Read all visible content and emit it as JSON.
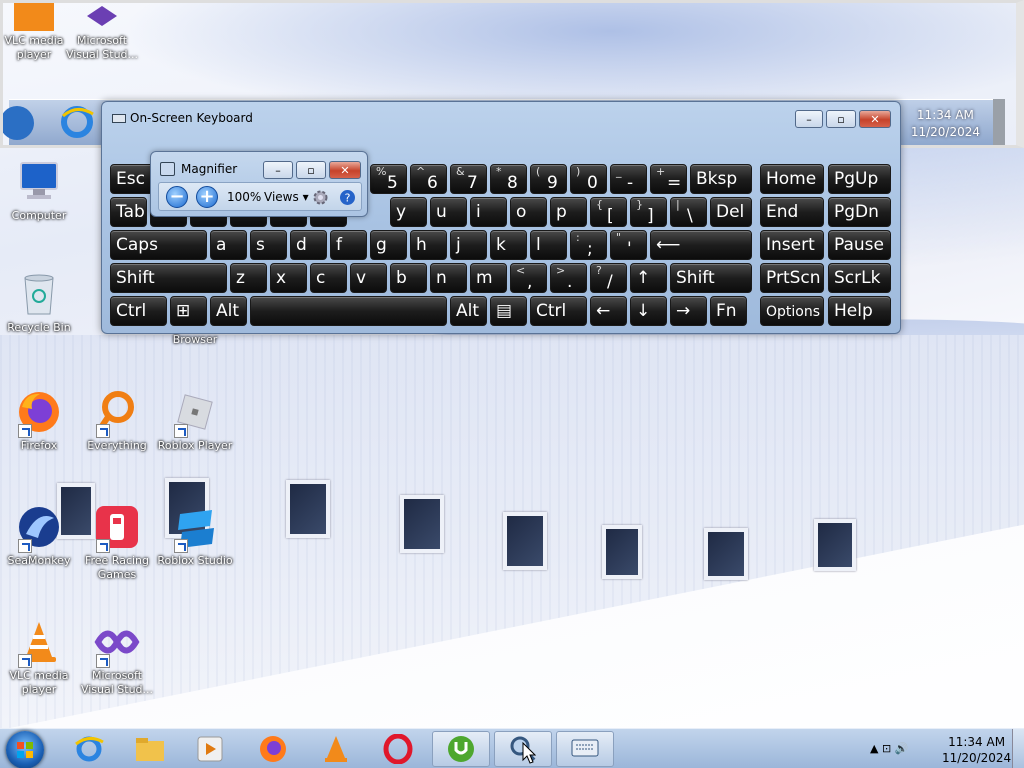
{
  "magnified_view": {
    "icons": [
      "VLC media player",
      "Microsoft Visual Stud..."
    ],
    "time": "11:34 AM",
    "date": "11/20/2024"
  },
  "desktop": {
    "icons": [
      {
        "label": "Computer",
        "icon": "computer-icon"
      },
      {
        "label": "Recycle Bin",
        "icon": "recycle-bin-icon"
      },
      {
        "label": "Browser",
        "icon": "browser-icon"
      },
      {
        "label": "Firefox",
        "icon": "firefox-icon"
      },
      {
        "label": "Everything",
        "icon": "everything-icon"
      },
      {
        "label": "Roblox Player",
        "icon": "roblox-player-icon"
      },
      {
        "label": "SeaMonkey",
        "icon": "seamonkey-icon"
      },
      {
        "label": "Free Racing Games",
        "icon": "racing-games-icon"
      },
      {
        "label": "Roblox Studio",
        "icon": "roblox-studio-icon"
      },
      {
        "label": "VLC media player",
        "icon": "vlc-icon"
      },
      {
        "label": "Microsoft Visual Stud...",
        "icon": "visual-studio-icon"
      }
    ]
  },
  "osk": {
    "title": "On-Screen Keyboard",
    "rows": [
      [
        {
          "s": "",
          "m": "Esc"
        },
        {
          "s": "",
          "m": ""
        },
        {
          "s": "",
          "m": ""
        },
        {
          "s": "",
          "m": ""
        },
        {
          "s": "",
          "m": ""
        },
        {
          "s": "",
          "m": ""
        },
        {
          "s": "%",
          "m": "5"
        },
        {
          "s": "^",
          "m": "6"
        },
        {
          "s": "&",
          "m": "7"
        },
        {
          "s": "*",
          "m": "8"
        },
        {
          "s": "(",
          "m": "9"
        },
        {
          "s": ")",
          "m": "0"
        },
        {
          "s": "_",
          "m": "-"
        },
        {
          "s": "+",
          "m": "="
        },
        {
          "s": "",
          "m": "Bksp"
        },
        {
          "s": "",
          "m": "Home"
        },
        {
          "s": "",
          "m": "PgUp"
        }
      ],
      [
        {
          "s": "",
          "m": "Tab"
        },
        {
          "s": "",
          "m": ""
        },
        {
          "s": "",
          "m": ""
        },
        {
          "s": "",
          "m": ""
        },
        {
          "s": "",
          "m": ""
        },
        {
          "s": "",
          "m": ""
        },
        {
          "s": "",
          "m": "y"
        },
        {
          "s": "",
          "m": "u"
        },
        {
          "s": "",
          "m": "i"
        },
        {
          "s": "",
          "m": "o"
        },
        {
          "s": "",
          "m": "p"
        },
        {
          "s": "{",
          "m": "["
        },
        {
          "s": "}",
          "m": "]"
        },
        {
          "s": "|",
          "m": "\\"
        },
        {
          "s": "",
          "m": "Del"
        },
        {
          "s": "",
          "m": "End"
        },
        {
          "s": "",
          "m": "PgDn"
        }
      ],
      [
        {
          "s": "",
          "m": "Caps"
        },
        {
          "s": "",
          "m": "a"
        },
        {
          "s": "",
          "m": "s"
        },
        {
          "s": "",
          "m": "d"
        },
        {
          "s": "",
          "m": "f"
        },
        {
          "s": "",
          "m": "g"
        },
        {
          "s": "",
          "m": "h"
        },
        {
          "s": "",
          "m": "j"
        },
        {
          "s": "",
          "m": "k"
        },
        {
          "s": "",
          "m": "l"
        },
        {
          "s": ":",
          "m": ";"
        },
        {
          "s": "\"",
          "m": "'"
        },
        {
          "s": "",
          "m": "⟵"
        },
        {
          "s": "",
          "m": "Insert"
        },
        {
          "s": "",
          "m": "Pause"
        }
      ],
      [
        {
          "s": "",
          "m": "Shift"
        },
        {
          "s": "",
          "m": "z"
        },
        {
          "s": "",
          "m": "x"
        },
        {
          "s": "",
          "m": "c"
        },
        {
          "s": "",
          "m": "v"
        },
        {
          "s": "",
          "m": "b"
        },
        {
          "s": "",
          "m": "n"
        },
        {
          "s": "",
          "m": "m"
        },
        {
          "s": "<",
          "m": ","
        },
        {
          "s": ">",
          "m": "."
        },
        {
          "s": "?",
          "m": "/"
        },
        {
          "s": "",
          "m": "↑"
        },
        {
          "s": "",
          "m": "Shift"
        },
        {
          "s": "",
          "m": "PrtScn"
        },
        {
          "s": "",
          "m": "ScrLk"
        }
      ],
      [
        {
          "s": "",
          "m": "Ctrl"
        },
        {
          "s": "",
          "m": "⊞"
        },
        {
          "s": "",
          "m": "Alt"
        },
        {
          "s": "",
          "m": ""
        },
        {
          "s": "",
          "m": "Alt"
        },
        {
          "s": "",
          "m": "▤"
        },
        {
          "s": "",
          "m": "Ctrl"
        },
        {
          "s": "",
          "m": "←"
        },
        {
          "s": "",
          "m": "↓"
        },
        {
          "s": "",
          "m": "→"
        },
        {
          "s": "",
          "m": "Fn"
        },
        {
          "s": "",
          "m": "Options"
        },
        {
          "s": "",
          "m": "Help"
        }
      ]
    ]
  },
  "magnifier": {
    "title": "Magnifier",
    "zoom": "100%",
    "views": "Views"
  },
  "taskbar": {
    "time": "11:34 AM",
    "date": "11/20/2024",
    "tray": "▲ ⊡ 🔊"
  }
}
